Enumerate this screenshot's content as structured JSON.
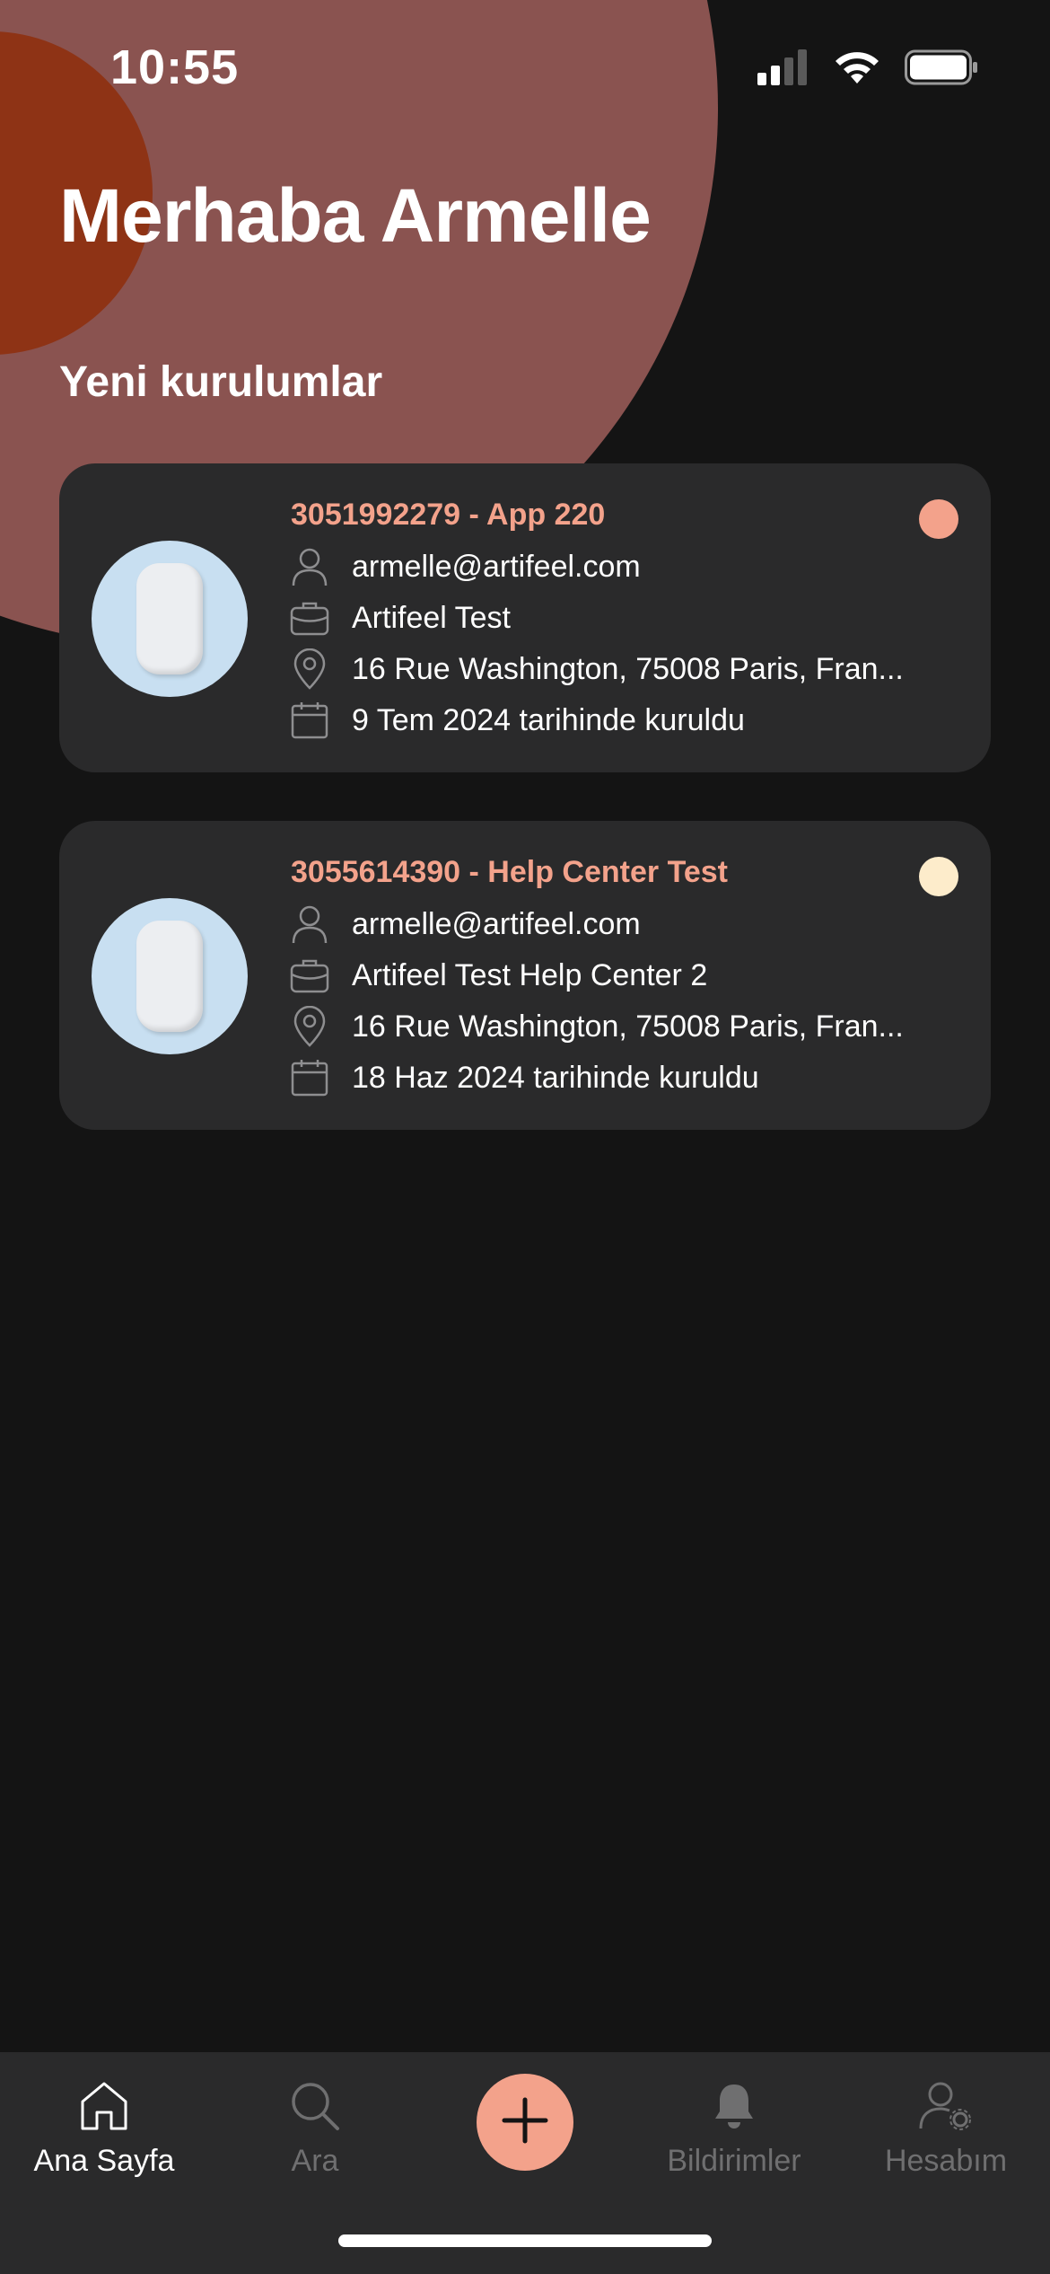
{
  "status_bar": {
    "time": "10:55",
    "icons": [
      "signal-icon",
      "wifi-icon",
      "battery-icon"
    ]
  },
  "greeting": "Merhaba Armelle",
  "section_title": "Yeni kurulumlar",
  "installations": [
    {
      "title": "3051992279 - App 220",
      "status_color": "#f3a28b",
      "email": "armelle@artifeel.com",
      "company": "Artifeel Test",
      "address": "16 Rue Washington, 75008 Paris, Fran...",
      "installed": "9 Tem 2024 tarihinde kuruldu"
    },
    {
      "title": "3055614390 - Help Center Test",
      "status_color": "#fdeccb",
      "email": "armelle@artifeel.com",
      "company": "Artifeel Test Help Center 2",
      "address": "16 Rue Washington, 75008 Paris, Fran...",
      "installed": "18 Haz 2024 tarihinde kuruldu"
    }
  ],
  "tabbar": {
    "home": "Ana Sayfa",
    "search": "Ara",
    "notifications": "Bildirimler",
    "account": "Hesabım",
    "active": "home"
  },
  "colors": {
    "accent": "#f3a28b",
    "background": "#141414",
    "card": "#2a2a2b"
  }
}
